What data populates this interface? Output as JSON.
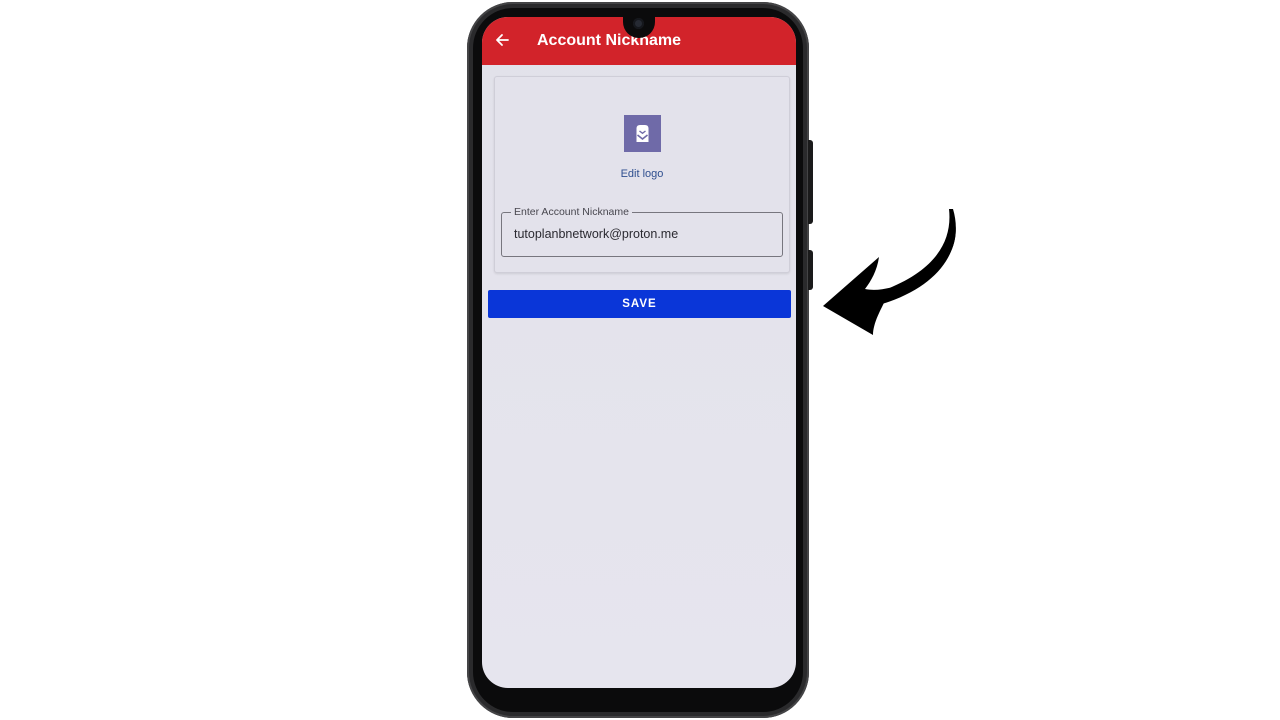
{
  "appbar": {
    "title": "Account Nickname",
    "back_icon": "arrow-left-icon",
    "color": "#d2232a"
  },
  "card": {
    "logo_icon": "proton-mail-logo-icon",
    "logo_color": "#6f6aa8",
    "edit_logo_label": "Edit logo",
    "nickname_field": {
      "label": "Enter Account Nickname",
      "value": "tutoplanbnetwork@proton.me"
    }
  },
  "save_button": {
    "label": "SAVE",
    "color": "#0a36d8"
  },
  "annotation": {
    "icon": "curved-arrow-pointer-icon",
    "color": "#000000"
  }
}
